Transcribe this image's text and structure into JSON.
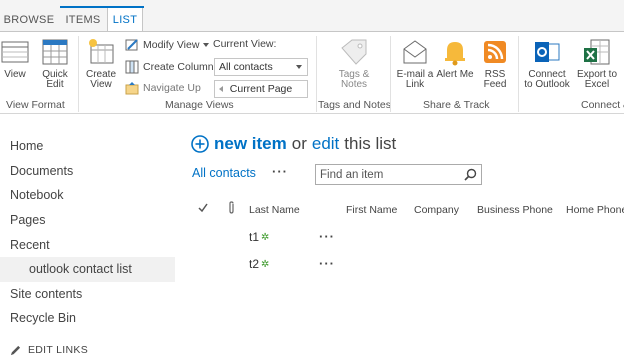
{
  "tabs": [
    {
      "label": "BROWSE"
    },
    {
      "label": "ITEMS"
    },
    {
      "label": "LIST"
    }
  ],
  "ribbon": {
    "view_format": {
      "label": "View Format",
      "view_label": "View",
      "quick_edit_label": "Quick Edit"
    },
    "manage_views": {
      "label": "Manage Views",
      "create_view_label": "Create View",
      "modify_view_label": "Modify View",
      "create_column_label": "Create Column",
      "navigate_up_label": "Navigate Up",
      "current_view_label": "Current View:",
      "current_view_value": "All contacts",
      "current_page_label": "Current Page"
    },
    "tags_notes": {
      "label": "Tags and Notes",
      "tags_notes_label": "Tags & Notes"
    },
    "share_track": {
      "label": "Share & Track",
      "email_link_label": "E-mail a Link",
      "alert_me_label": "Alert Me",
      "rss_feed_label": "RSS Feed"
    },
    "connect_export": {
      "label": "Connect &",
      "connect_outlook_label": "Connect to Outlook",
      "export_excel_label": "Export to Excel"
    }
  },
  "leftnav": {
    "items": [
      {
        "label": "Home"
      },
      {
        "label": "Documents"
      },
      {
        "label": "Notebook"
      },
      {
        "label": "Pages"
      },
      {
        "label": "Recent"
      },
      {
        "label": "outlook contact list"
      },
      {
        "label": "Site contents"
      },
      {
        "label": "Recycle Bin"
      }
    ],
    "edit_links_label": "EDIT LINKS"
  },
  "main": {
    "new_item_text": "new item",
    "or_text": "or",
    "edit_text": "edit",
    "this_list_text": "this list",
    "view_link": "All contacts",
    "search_placeholder": "Find an item",
    "columns": [
      "Last Name",
      "First Name",
      "Company",
      "Business Phone",
      "Home Phone"
    ],
    "rows": [
      {
        "last_name": "t1"
      },
      {
        "last_name": "t2"
      }
    ],
    "new_marker": "✲"
  },
  "colors": {
    "accent": "#0072c6",
    "new_badge": "#3c9a2a"
  }
}
